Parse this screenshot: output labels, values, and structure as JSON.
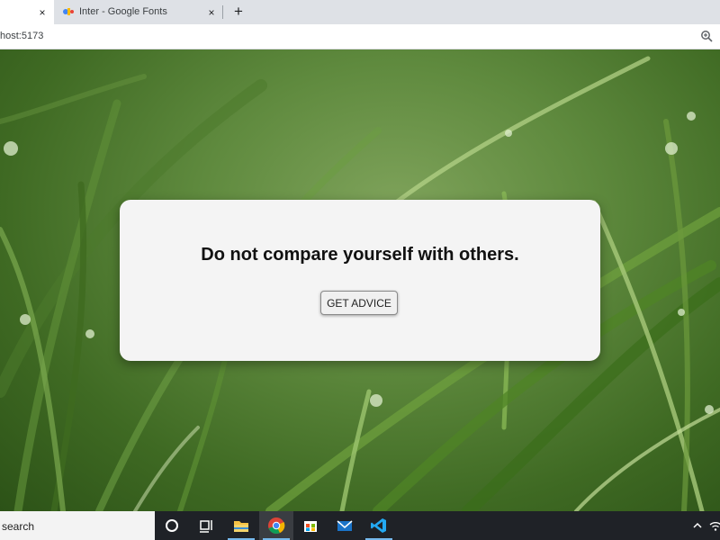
{
  "browser": {
    "active_tab": {
      "close_glyph": "×"
    },
    "inactive_tab": {
      "title": "Inter - Google Fonts",
      "close_glyph": "×",
      "favicon": "google-fonts-icon"
    },
    "new_tab_glyph": "+",
    "url": "host:5173",
    "zoom_icon": "magnifier-zoom-icon"
  },
  "card": {
    "advice": "Do not compare yourself with others.",
    "button_label": "GET ADVICE"
  },
  "taskbar": {
    "search_text": "search",
    "items": [
      "cortana-icon",
      "task-view-icon",
      "file-explorer-icon",
      "chrome-icon",
      "microsoft-store-icon",
      "mail-icon",
      "vscode-icon"
    ],
    "tray": [
      "chevron-up-icon",
      "wifi-icon"
    ]
  },
  "colors": {
    "card_bg": "#f4f4f4",
    "taskbar_bg": "#1f2227",
    "accent": "#76b9ed"
  }
}
